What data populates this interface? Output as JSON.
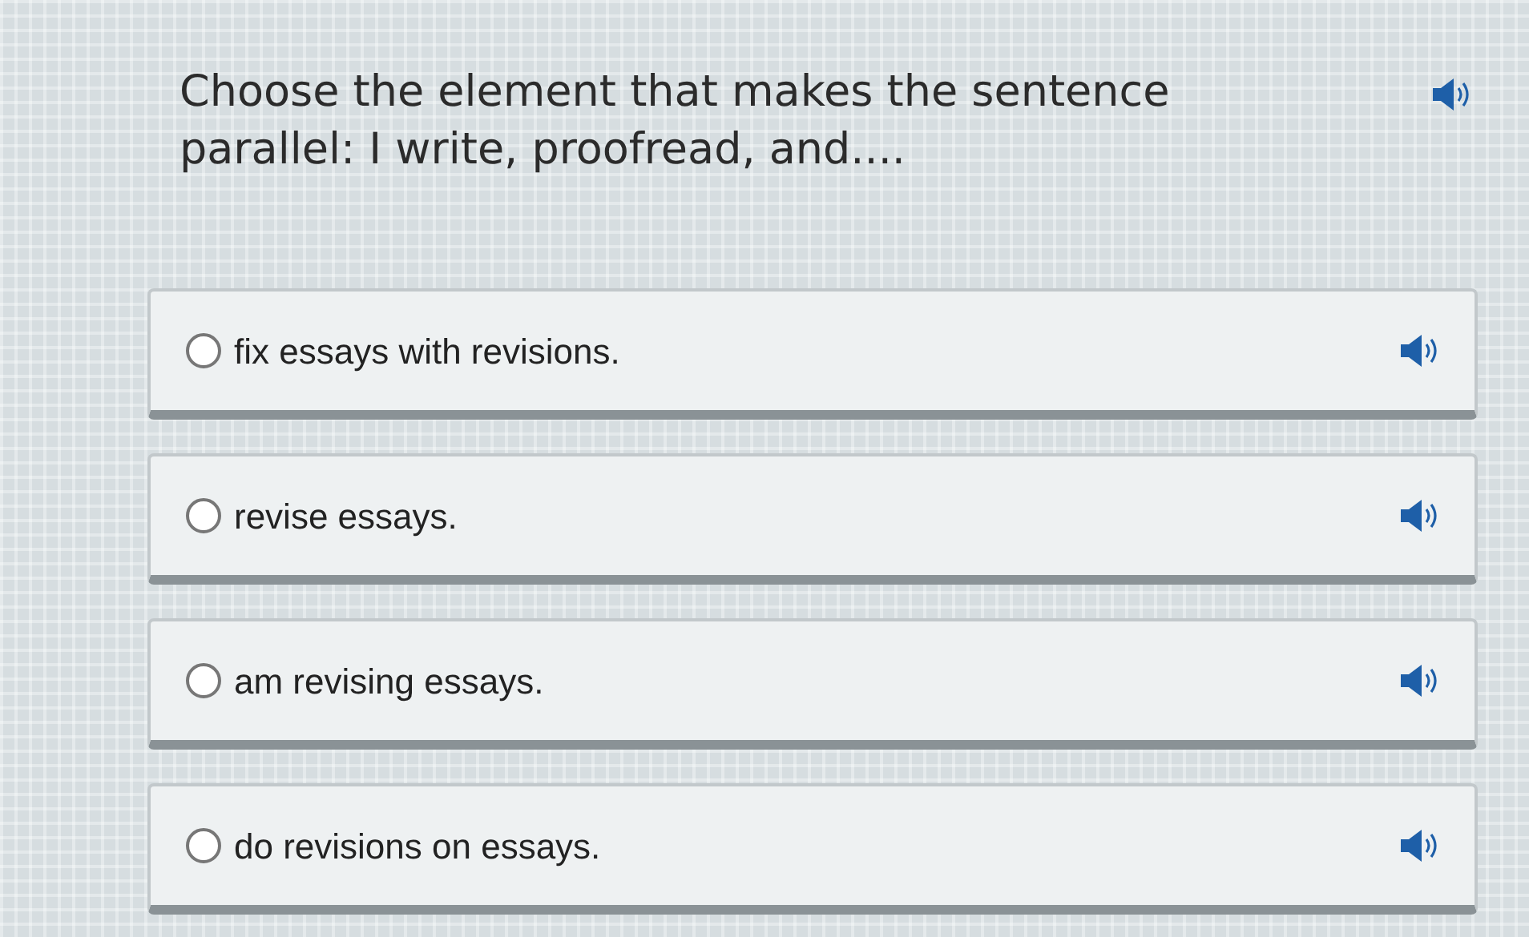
{
  "question": {
    "text": "Choose the element that makes the sentence parallel: I write, proofread, and...."
  },
  "options": [
    {
      "text": "fix essays with revisions.",
      "selected": false
    },
    {
      "text": "revise essays.",
      "selected": false
    },
    {
      "text": "am revising essays.",
      "selected": false
    },
    {
      "text": "do revisions on essays.",
      "selected": false
    }
  ]
}
